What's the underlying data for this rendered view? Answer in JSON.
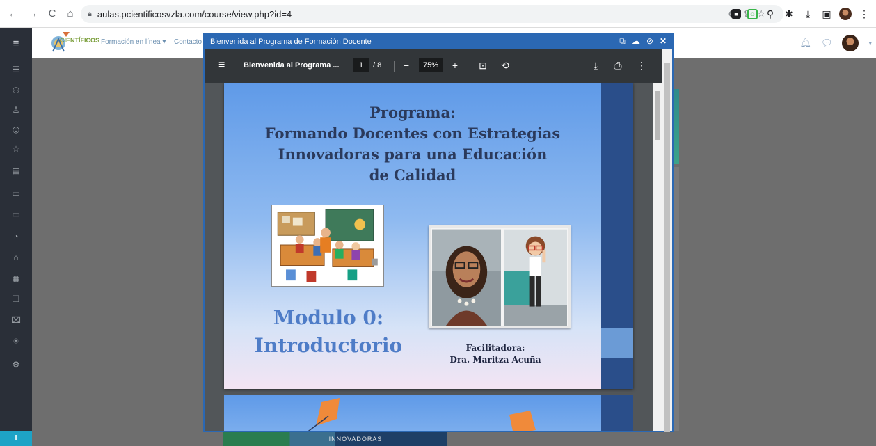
{
  "browser": {
    "url": "aulas.pcientificosvzla.com/course/view.php?id=4",
    "back": "←",
    "forward": "→",
    "reload": "C",
    "home": "⌂"
  },
  "site": {
    "logo_text": "CIENTÍFICOS",
    "nav_formacion": "Formación en línea ▾",
    "nav_contacto": "Contacto"
  },
  "modal": {
    "title": "Bienvenida al Programa de Formación Docente"
  },
  "pdf": {
    "doc_title": "Bienvenida al Programa ...",
    "page_current": "1",
    "page_total": "/ 8",
    "zoom": "75%"
  },
  "slide": {
    "title_lines": [
      "Programa:",
      "Formando Docentes con Estrategias",
      "Innovadoras para una Educación",
      "de Calidad"
    ],
    "modulo_line1": "Modulo 0:",
    "modulo_line2": "Introductorio",
    "facilitadora_label": "Facilitadora:",
    "facilitadora_name": "Dra. Maritza Acuña"
  },
  "background": {
    "bottom_strip_text": "INNOVADORAS"
  },
  "colors": {
    "modal_blue": "#2b68b3",
    "sidebar_dark": "#2a2f38",
    "slide_title": "#2b3a5c",
    "modulo_blue": "#4e7cc7"
  }
}
